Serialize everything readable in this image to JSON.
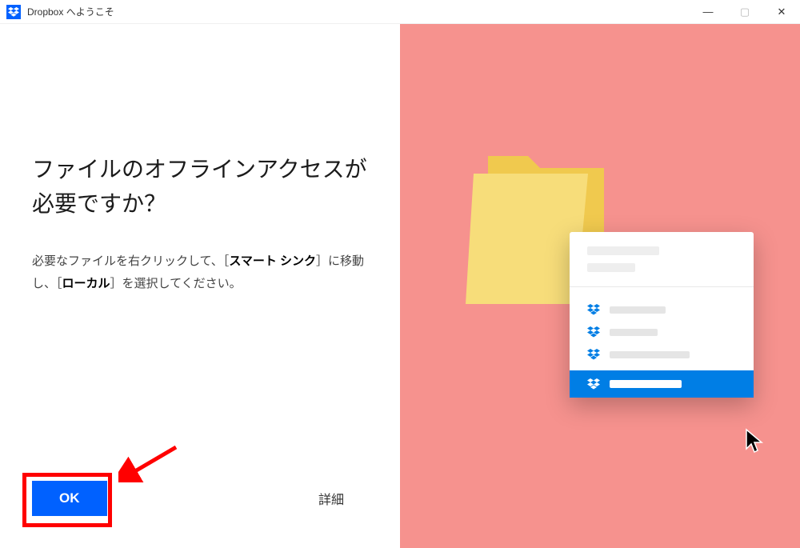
{
  "window": {
    "title": "Dropbox へようこそ"
  },
  "main": {
    "heading": "ファイルのオフラインアクセスが必要ですか？",
    "desc_part1": "必要なファイルを右クリックして、［",
    "desc_bold1": "スマート シンク",
    "desc_part2": "］に移動し、［",
    "desc_bold2": "ローカル",
    "desc_part3": "］を選択してください。"
  },
  "buttons": {
    "ok": "OK",
    "details": "詳細"
  },
  "window_controls": {
    "minimize": "—",
    "maximize": "▢",
    "close": "✕"
  },
  "colors": {
    "accent": "#0061ff",
    "right_bg": "#f6928e",
    "highlight": "#ff0000"
  }
}
